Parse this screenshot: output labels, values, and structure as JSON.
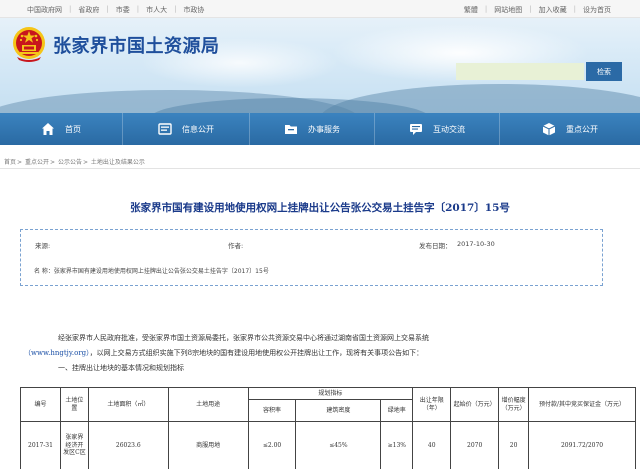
{
  "topbar": {
    "left_links": [
      "中国政府网",
      "省政府",
      "市委",
      "市人大",
      "市政协"
    ],
    "right_links": [
      "繁體",
      "网站地图",
      "加入收藏",
      "设为首页"
    ]
  },
  "header": {
    "site_title": "张家界市国土资源局",
    "search_placeholder": "",
    "search_button": "检索"
  },
  "nav": {
    "items": [
      {
        "label": "首页",
        "icon": "home-icon"
      },
      {
        "label": "信息公开",
        "icon": "info-icon"
      },
      {
        "label": "办事服务",
        "icon": "folder-icon"
      },
      {
        "label": "互动交流",
        "icon": "chat-icon"
      },
      {
        "label": "重点公开",
        "icon": "cube-icon"
      }
    ]
  },
  "breadcrumb": [
    "首页",
    "重点公开",
    "公示公告",
    "土地出让及结果公示"
  ],
  "document": {
    "title": "张家界市国有建设用地使用权网上挂牌出让公告张公交易土挂告字〔2017〕15号",
    "source_label": "来源:",
    "author_label": "作者:",
    "date_label": "发布日期：",
    "date_value": "2017-10-30",
    "name_line": "名 称：张家界市国有建设用地使用权网上挂牌出让公告张公交易土挂告字〔2017〕15号",
    "para1": "经张家界市人民政府批准，受张家界市国土资源局委托，张家界市公共资源交易中心将通过湖南省国土资源网上交易系统",
    "para2_url": "（www.hngtjy.org）",
    "para2_rest": "，以网上交易方式组织实施下列8宗地块的国有建设用地使用权公开挂牌出让工作，现将有关事项公告如下：",
    "para3": "一、挂牌出让地块的基本情况和规划指标"
  },
  "table": {
    "headers": {
      "number": "编号",
      "location": "土地位置",
      "area": "土地面积（㎡）",
      "use": "土地用途",
      "plan": "规划指标",
      "plot_ratio": "容积率",
      "density": "建筑密度",
      "green": "绿地率",
      "term": "出让年限（年）",
      "start_price": "起始价（万元）",
      "increment": "增价幅度（万元）",
      "deposit": "预付款/其中竞买保证金（万元）"
    },
    "rows": [
      {
        "number": "2017-31",
        "location": "张家界经济开发区C区",
        "area": "26023.6",
        "use": "商服用地",
        "plot_ratio": "≤2.00",
        "density": "≤45%",
        "green": "≥13%",
        "term": "40",
        "start_price": "2070",
        "increment": "20",
        "deposit": "2091.72/2070"
      }
    ]
  },
  "colors": {
    "nav_blue": "#2a6aa3",
    "title_blue": "#1f4f9c",
    "emblem_red": "#c8161d",
    "emblem_gold": "#f5c518"
  }
}
